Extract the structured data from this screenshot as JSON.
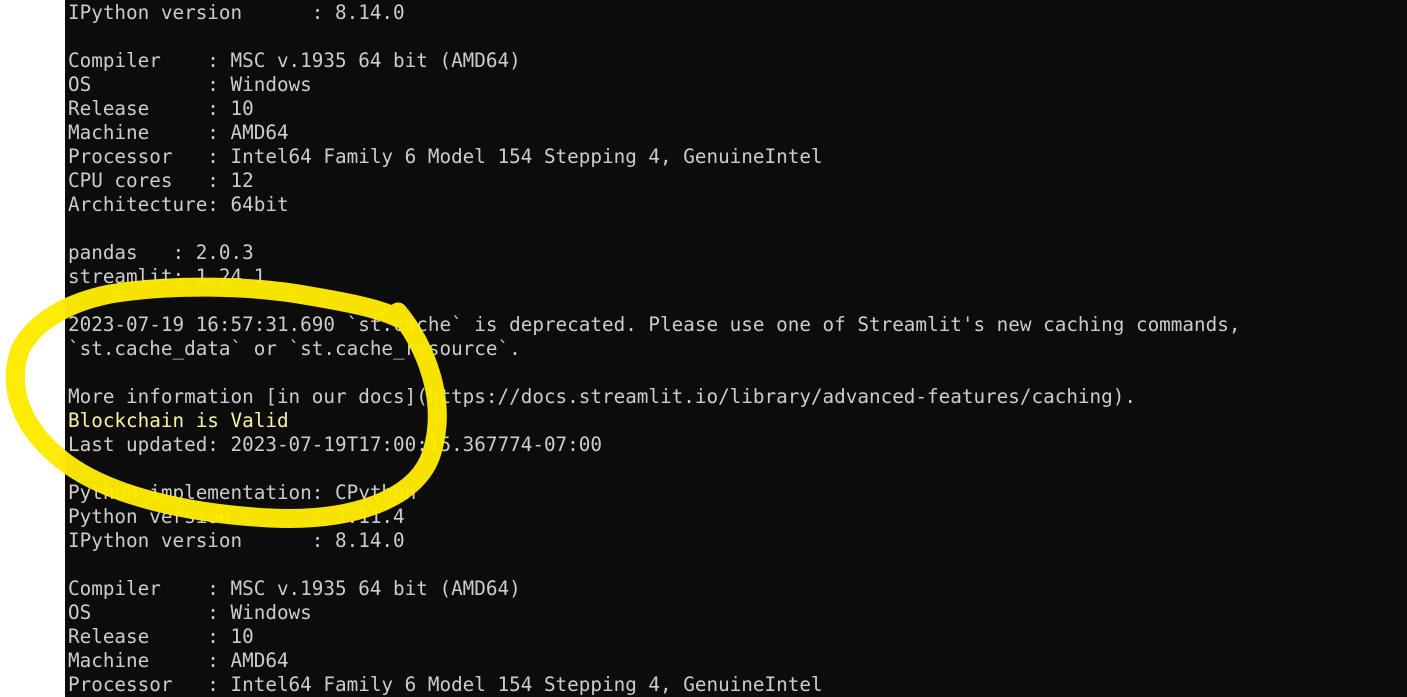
{
  "colors": {
    "terminal_background": "#0c0c0c",
    "terminal_text": "#cccccc",
    "highlight_text": "#f9f1a5",
    "annotation_circle": "#ffea00",
    "page_margin": "#ffffff"
  },
  "terminal": {
    "lines": [
      {
        "text": "IPython version      : 8.14.0",
        "highlight": false
      },
      {
        "text": "",
        "highlight": false
      },
      {
        "text": "Compiler    : MSC v.1935 64 bit (AMD64)",
        "highlight": false
      },
      {
        "text": "OS          : Windows",
        "highlight": false
      },
      {
        "text": "Release     : 10",
        "highlight": false
      },
      {
        "text": "Machine     : AMD64",
        "highlight": false
      },
      {
        "text": "Processor   : Intel64 Family 6 Model 154 Stepping 4, GenuineIntel",
        "highlight": false
      },
      {
        "text": "CPU cores   : 12",
        "highlight": false
      },
      {
        "text": "Architecture: 64bit",
        "highlight": false
      },
      {
        "text": "",
        "highlight": false
      },
      {
        "text": "pandas   : 2.0.3",
        "highlight": false
      },
      {
        "text": "streamlit: 1.24.1",
        "highlight": false
      },
      {
        "text": "",
        "highlight": false
      },
      {
        "text": "2023-07-19 16:57:31.690 `st.cache` is deprecated. Please use one of Streamlit's new caching commands,",
        "highlight": false
      },
      {
        "text": "`st.cache_data` or `st.cache_resource`.",
        "highlight": false
      },
      {
        "text": "",
        "highlight": false
      },
      {
        "text": "More information [in our docs](https://docs.streamlit.io/library/advanced-features/caching).",
        "highlight": false
      },
      {
        "text": "Blockchain is Valid",
        "highlight": true
      },
      {
        "text": "Last updated: 2023-07-19T17:00:15.367774-07:00",
        "highlight": false
      },
      {
        "text": "",
        "highlight": false
      },
      {
        "text": "Python implementation: CPython",
        "highlight": false
      },
      {
        "text": "Python version       : 3.11.4",
        "highlight": false
      },
      {
        "text": "IPython version      : 8.14.0",
        "highlight": false
      },
      {
        "text": "",
        "highlight": false
      },
      {
        "text": "Compiler    : MSC v.1935 64 bit (AMD64)",
        "highlight": false
      },
      {
        "text": "OS          : Windows",
        "highlight": false
      },
      {
        "text": "Release     : 10",
        "highlight": false
      },
      {
        "text": "Machine     : AMD64",
        "highlight": false
      },
      {
        "text": "Processor   : Intel64 Family 6 Model 154 Stepping 4, GenuineIntel",
        "highlight": false
      }
    ]
  }
}
